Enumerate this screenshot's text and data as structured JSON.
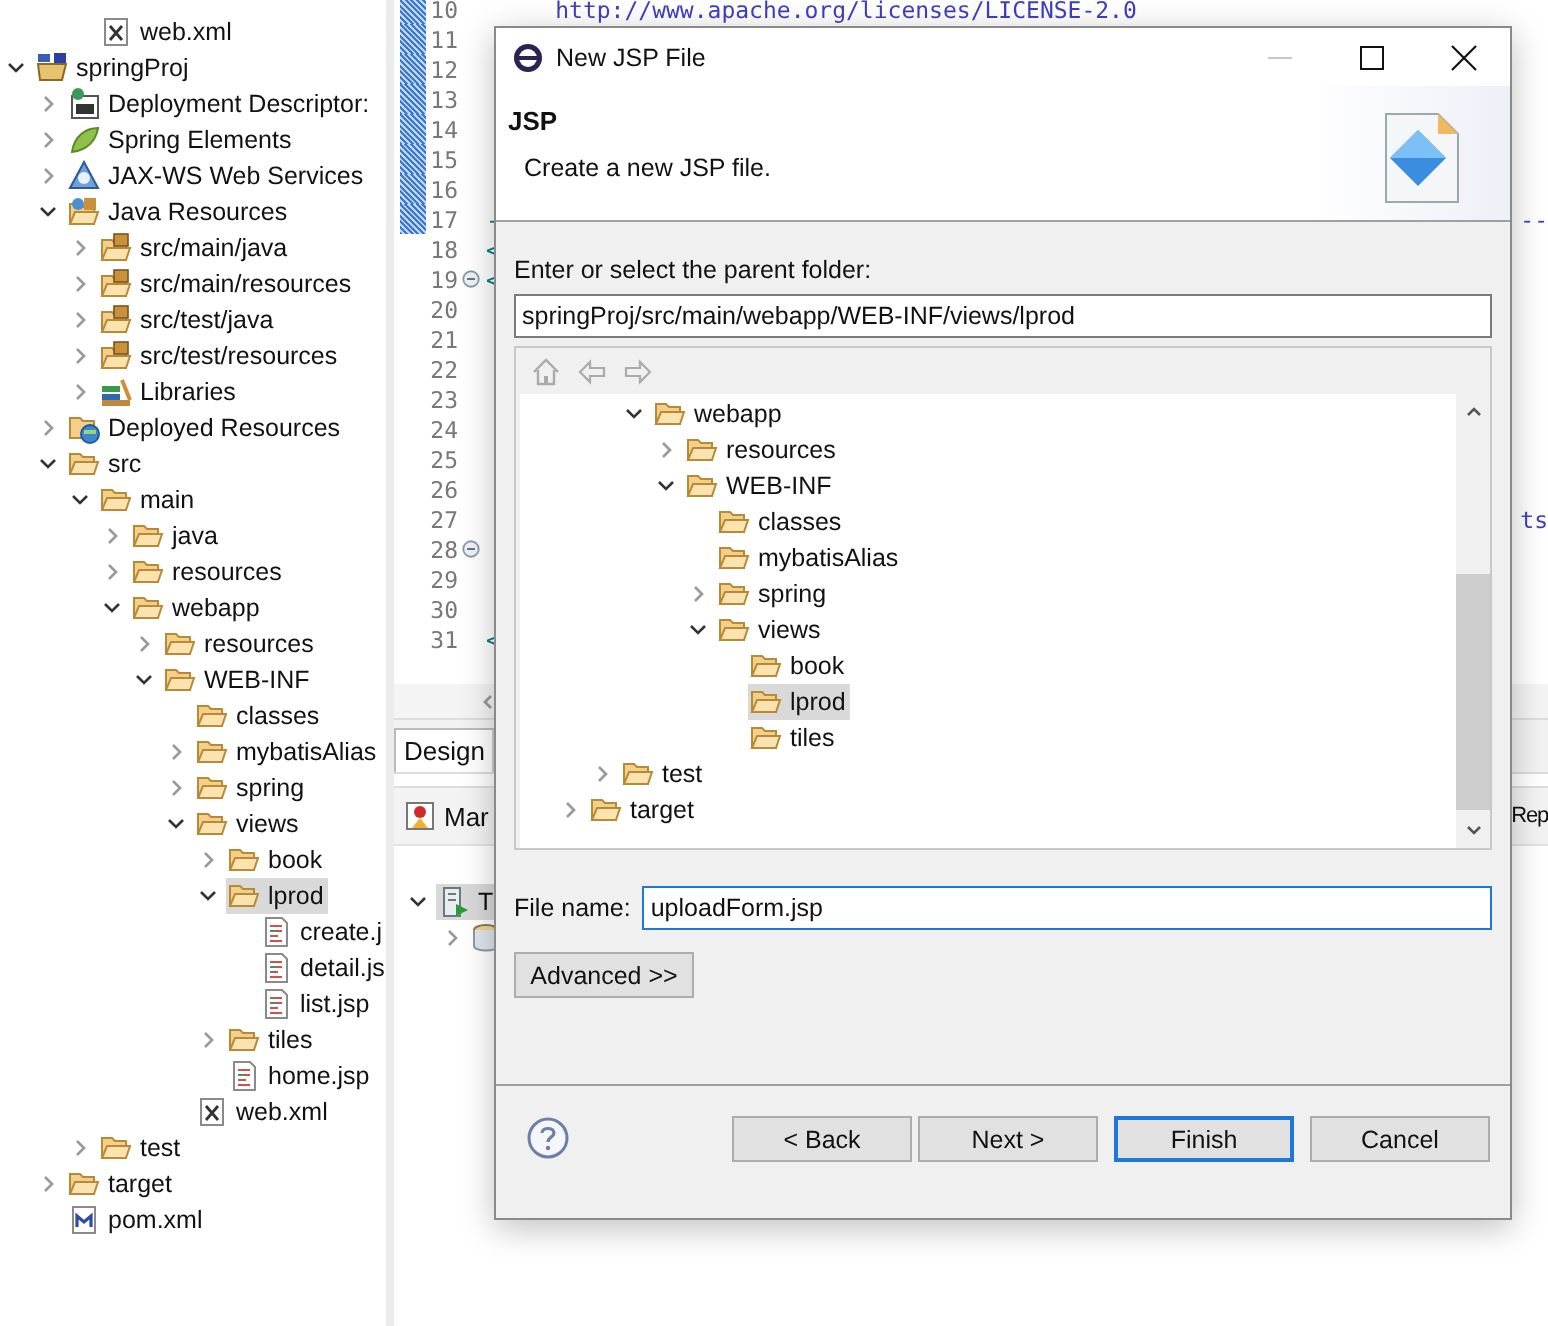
{
  "explorer": {
    "items": [
      {
        "children": [
          {
            "children": [
              {
                "label": "web.xml",
                "kind": "xml",
                "selected": false
              }
            ]
          }
        ]
      },
      {
        "label": "springProj",
        "kind": "project",
        "expanded": true,
        "selected": false,
        "children": [
          {
            "label": "Deployment Descriptor:",
            "kind": "descriptor",
            "expanded": false,
            "selected": false
          },
          {
            "label": "Spring Elements",
            "kind": "spring",
            "expanded": false,
            "selected": false
          },
          {
            "label": "JAX-WS Web Services",
            "kind": "webservices",
            "expanded": false,
            "selected": false
          },
          {
            "label": "Java Resources",
            "kind": "java-resources",
            "expanded": true,
            "selected": false,
            "children": [
              {
                "label": "src/main/java",
                "kind": "source-folder",
                "expanded": false,
                "selected": false
              },
              {
                "label": "src/main/resources",
                "kind": "source-folder",
                "expanded": false,
                "selected": false
              },
              {
                "label": "src/test/java",
                "kind": "source-folder",
                "expanded": false,
                "selected": false
              },
              {
                "label": "src/test/resources",
                "kind": "source-folder",
                "expanded": false,
                "selected": false
              },
              {
                "label": "Libraries",
                "kind": "library",
                "expanded": false,
                "selected": false
              }
            ]
          },
          {
            "label": "Deployed Resources",
            "kind": "deployed",
            "expanded": false,
            "selected": false
          },
          {
            "label": "src",
            "expanded": true,
            "selected": false,
            "children": [
              {
                "label": "main",
                "expanded": true,
                "selected": false,
                "children": [
                  {
                    "label": "java",
                    "expanded": false,
                    "selected": false
                  },
                  {
                    "label": "resources",
                    "expanded": false,
                    "selected": false
                  },
                  {
                    "label": "webapp",
                    "expanded": true,
                    "selected": false,
                    "children": [
                      {
                        "label": "resources",
                        "expanded": false,
                        "selected": false
                      },
                      {
                        "label": "WEB-INF",
                        "expanded": true,
                        "selected": false,
                        "children": [
                          {
                            "label": "classes",
                            "selected": false
                          },
                          {
                            "label": "mybatisAlias",
                            "expanded": false,
                            "selected": false
                          },
                          {
                            "label": "spring",
                            "expanded": false,
                            "selected": false
                          },
                          {
                            "label": "views",
                            "expanded": true,
                            "selected": false,
                            "children": [
                              {
                                "label": "book",
                                "expanded": false,
                                "selected": false
                              },
                              {
                                "label": "lprod",
                                "expanded": true,
                                "selected": true,
                                "children": [
                                  {
                                    "label": "create.j",
                                    "kind": "jsp",
                                    "selected": false
                                  },
                                  {
                                    "label": "detail.js",
                                    "kind": "jsp",
                                    "selected": false
                                  },
                                  {
                                    "label": "list.jsp",
                                    "kind": "jsp",
                                    "selected": false
                                  }
                                ]
                              },
                              {
                                "label": "tiles",
                                "expanded": false,
                                "selected": false
                              },
                              {
                                "label": "home.jsp",
                                "kind": "jsp",
                                "selected": false
                              }
                            ]
                          },
                          {
                            "label": "web.xml",
                            "kind": "xml",
                            "selected": false
                          }
                        ]
                      }
                    ]
                  }
                ]
              },
              {
                "label": "test",
                "expanded": false,
                "selected": false
              }
            ]
          },
          {
            "label": "target",
            "expanded": false,
            "selected": false
          },
          {
            "label": "pom.xml",
            "kind": "pom",
            "selected": false
          }
        ]
      }
    ]
  },
  "editor": {
    "lines": [
      {
        "number": "10",
        "changed": true,
        "foldable": false,
        "left": "     http://www.apache.org/licenses/LICENSE-2.0"
      },
      {
        "number": "11",
        "changed": true,
        "foldable": false
      },
      {
        "number": "12",
        "changed": true,
        "foldable": false
      },
      {
        "number": "13",
        "changed": true,
        "foldable": false
      },
      {
        "number": "14",
        "changed": true,
        "foldable": false
      },
      {
        "number": "15",
        "changed": true,
        "foldable": false
      },
      {
        "number": "16",
        "changed": true,
        "foldable": false
      },
      {
        "number": "17",
        "changed": true,
        "foldable": false,
        "left": "-",
        "right": "--"
      },
      {
        "number": "18",
        "changed": false,
        "foldable": false,
        "left": "<"
      },
      {
        "number": "19",
        "changed": false,
        "foldable": true,
        "left": "<"
      },
      {
        "number": "20",
        "changed": false,
        "foldable": false
      },
      {
        "number": "21",
        "changed": false,
        "foldable": false
      },
      {
        "number": "22",
        "changed": false,
        "foldable": false
      },
      {
        "number": "23",
        "changed": false,
        "foldable": false
      },
      {
        "number": "24",
        "changed": false,
        "foldable": false
      },
      {
        "number": "25",
        "changed": false,
        "foldable": false
      },
      {
        "number": "26",
        "changed": false,
        "foldable": false
      },
      {
        "number": "27",
        "changed": false,
        "foldable": false,
        "right": "ts"
      },
      {
        "number": "28",
        "changed": false,
        "foldable": true
      },
      {
        "number": "29",
        "changed": false,
        "foldable": false
      },
      {
        "number": "30",
        "changed": false,
        "foldable": false
      },
      {
        "number": "31",
        "changed": false,
        "foldable": false,
        "left": "<"
      }
    ],
    "tabs": [
      {
        "label": "Design",
        "selected": true
      }
    ]
  },
  "bottom_panel": {
    "tabs": [
      {
        "label": "Mar"
      },
      {
        "label": "Rep"
      }
    ],
    "items": [
      {
        "label": "T",
        "expanded": true,
        "selected": true,
        "children": [
          {
            "expanded": false
          }
        ]
      }
    ]
  },
  "dialog": {
    "title": "New JSP File",
    "heading": "JSP",
    "description": "Create a new JSP file.",
    "folder_label": "Enter or select the parent folder:",
    "folder_value": "springProj/src/main/webapp/WEB-INF/views/lprod",
    "tree": [
      {
        "children": [
          {
            "children": [
              {
                "label": "webapp",
                "expanded": true,
                "selected": false,
                "children": [
                  {
                    "label": "resources",
                    "expanded": false,
                    "selected": false
                  },
                  {
                    "label": "WEB-INF",
                    "expanded": true,
                    "selected": false,
                    "children": [
                      {
                        "label": "classes",
                        "selected": false
                      },
                      {
                        "label": "mybatisAlias",
                        "selected": false
                      },
                      {
                        "label": "spring",
                        "expanded": false,
                        "selected": false
                      },
                      {
                        "label": "views",
                        "expanded": true,
                        "selected": false,
                        "children": [
                          {
                            "label": "book",
                            "selected": false
                          },
                          {
                            "label": "lprod",
                            "selected": true
                          },
                          {
                            "label": "tiles",
                            "selected": false
                          }
                        ]
                      }
                    ]
                  }
                ]
              }
            ]
          },
          {
            "label": "test",
            "expanded": false,
            "selected": false
          }
        ]
      },
      {
        "label": "target",
        "expanded": false,
        "selected": false
      }
    ],
    "file_name_label": "File name:",
    "file_name_value": "uploadForm.jsp",
    "advanced_button": "Advanced >>",
    "buttons": [
      {
        "label": "< Back",
        "default": false
      },
      {
        "label": "Next >",
        "default": false
      },
      {
        "label": "Finish",
        "default": true
      },
      {
        "label": "Cancel",
        "default": false
      }
    ]
  }
}
